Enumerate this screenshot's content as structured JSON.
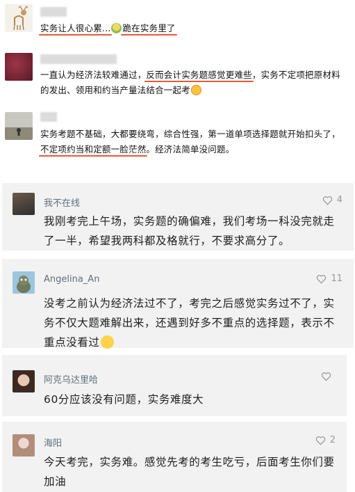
{
  "top_comments": [
    {
      "parts": [
        {
          "text": "实务让人很心累...",
          "highlight": true
        },
        {
          "emoji": "kneel-emoji"
        },
        {
          "text": "跪在实务里了",
          "highlight": true
        }
      ]
    },
    {
      "parts": [
        {
          "text": "一直认为经济法较难通过，",
          "highlight": false
        },
        {
          "text": "反而会计实务题感觉更难些",
          "highlight": true
        },
        {
          "text": "，实务不定项把原材料的发出、领用和约当产量法结合一起考",
          "highlight": false
        },
        {
          "emoji": "angry-emoji"
        }
      ]
    },
    {
      "parts": [
        {
          "text": "实务考题不基础，大都要绕弯，综合性强，第一道单项选择题就开始扣头了，",
          "highlight": false
        },
        {
          "text": "不定项约当和定额一脸茫然",
          "highlight": true
        },
        {
          "text": "。经济法简单没问题。",
          "highlight": false
        }
      ]
    }
  ],
  "cards": [
    {
      "name": "我不在线",
      "likes": "4",
      "text": "我刚考完上午场，实务题的确偏难，我们考场一科没完就走了一半，希望我两科都及格就行，不要求高分了。"
    },
    {
      "name": "Angelina_An",
      "likes": "11",
      "text": "没考之前认为经济法过不了，考完之后感觉实务过不了，实务不仅大题难解出来，还遇到好多不重点的选择题，表示不重点没看过"
    },
    {
      "name": "阿克乌达里哈",
      "likes": "",
      "text": "60分应该没有问题，实务难度大"
    },
    {
      "name": "海阳",
      "likes": "2",
      "text": "今天考完，实务难。感觉先考的考生吃亏，后面考生你们要加油"
    }
  ]
}
